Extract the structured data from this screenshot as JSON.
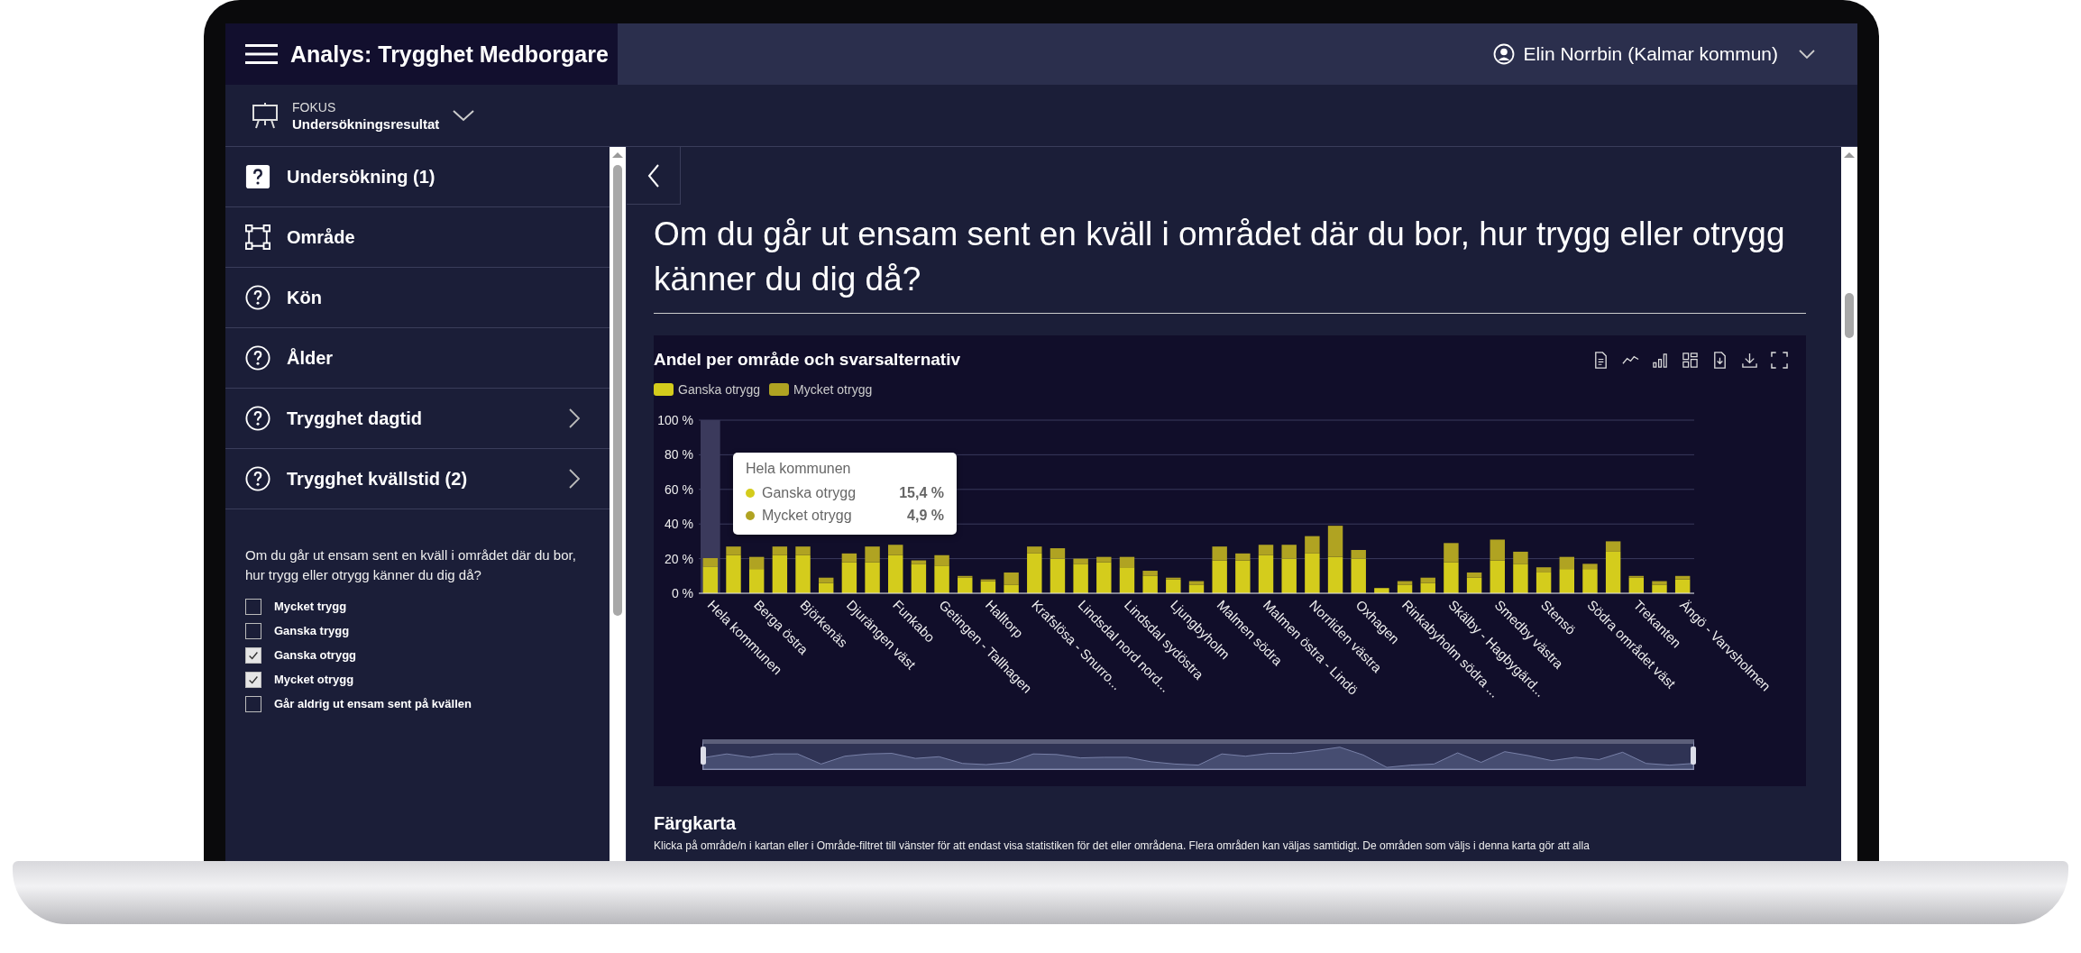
{
  "app_title": "Analys: Trygghet Medborgare",
  "user": {
    "name": "Elin Norrbin (Kalmar kommun)"
  },
  "focus": {
    "label": "FOKUS",
    "value": "Undersökningsresultat"
  },
  "sidebar": {
    "items": [
      {
        "label": "Undersökning (1)",
        "kind": "box",
        "submenu": false
      },
      {
        "label": "Område",
        "kind": "frame",
        "submenu": false
      },
      {
        "label": "Kön",
        "kind": "circle",
        "submenu": false
      },
      {
        "label": "Ålder",
        "kind": "circle",
        "submenu": false
      },
      {
        "label": "Trygghet dagtid",
        "kind": "circle",
        "submenu": true
      },
      {
        "label": "Trygghet kvällstid (2)",
        "kind": "circle",
        "submenu": true
      }
    ],
    "question": "Om du går ut ensam sent en kväll i området där du bor, hur trygg eller otrygg känner du dig då?",
    "options": [
      {
        "label": "Mycket trygg",
        "checked": false
      },
      {
        "label": "Ganska trygg",
        "checked": false
      },
      {
        "label": "Ganska otrygg",
        "checked": true
      },
      {
        "label": "Mycket otrygg",
        "checked": true
      },
      {
        "label": "Går aldrig ut ensam sent på kvällen",
        "checked": false
      }
    ]
  },
  "main": {
    "heading": "Om du går ut ensam sent en kväll i området där du bor, hur trygg eller otrygg känner du dig då?",
    "chart_panel": {
      "title": "Andel per område och svarsalternativ",
      "range_slider": {
        "level": 1
      },
      "tooltip": {
        "title": "Hela kommunen",
        "rows": [
          {
            "label": "Ganska otrygg",
            "value": "15,4 %",
            "color": "#d4cc1c"
          },
          {
            "label": "Mycket otrygg",
            "value": "4,9 %",
            "color": "#b0a322"
          }
        ]
      },
      "chart_data": {
        "type": "bar",
        "stacked": true,
        "grid": true,
        "legend": "top",
        "ylim": [
          0,
          100
        ],
        "yticks": [
          {
            "value": 0,
            "label": "0 %"
          },
          {
            "value": 20,
            "label": "20 %"
          },
          {
            "value": 40,
            "label": "40 %"
          },
          {
            "value": 60,
            "label": "60 %"
          },
          {
            "value": 80,
            "label": "80 %"
          },
          {
            "value": 100,
            "label": "100 %"
          }
        ],
        "categories": [
          "Hela kommunen",
          null,
          "Berga östra",
          null,
          "Björkenäs",
          null,
          "Djurängen väst",
          null,
          "Funkabo",
          null,
          "Getingen - Tallhagen",
          null,
          "Halltorp",
          null,
          "Krafslösa - Snurro...",
          null,
          "Lindsdal nord nord...",
          null,
          "Lindsdal sydöstra",
          null,
          "Ljungbyholm",
          null,
          "Malmen södra",
          null,
          "Malmen östra - Lindö",
          null,
          "Norrliden västra",
          null,
          "Oxhagen",
          null,
          "Rinkabyholm södra ...",
          null,
          "Skälby - Hagbygärd...",
          null,
          "Smedby västra",
          null,
          "Stensö",
          null,
          "Södra området väst",
          null,
          "Trekanten",
          null,
          "Ängö - Varvsholmen"
        ],
        "series": [
          {
            "name": "Ganska otrygg",
            "color": "#d4cc1c",
            "values": [
              15.4,
              22,
              14,
              22,
              22,
              6,
              18,
              18,
              22,
              17,
              16,
              9,
              7,
              5,
              23,
              20,
              17,
              18,
              15,
              10,
              8,
              5,
              19,
              19,
              22,
              20,
              23,
              21,
              20,
              3,
              5,
              6,
              18,
              9,
              19,
              17,
              12,
              14,
              14,
              24,
              9,
              5,
              8
            ]
          },
          {
            "name": "Mycket otrygg",
            "color": "#b0a322",
            "values": [
              4.9,
              5,
              7,
              5,
              5,
              3,
              5,
              9,
              6,
              2,
              6,
              1,
              1,
              7,
              4,
              6,
              3,
              3,
              6,
              3,
              1,
              2,
              8,
              4,
              6,
              8,
              10,
              18,
              5,
              0,
              2,
              3,
              11,
              3,
              12,
              7,
              3,
              7,
              3,
              6,
              1,
              2,
              2
            ]
          }
        ]
      }
    },
    "section": {
      "title": "Färgkarta",
      "text": "Klicka på område/n i kartan eller i Område-filtret till vänster för att endast visa statistiken för det eller områdena. Flera områden kan väljas samtidigt. De områden som väljs i denna karta gör att alla"
    }
  }
}
